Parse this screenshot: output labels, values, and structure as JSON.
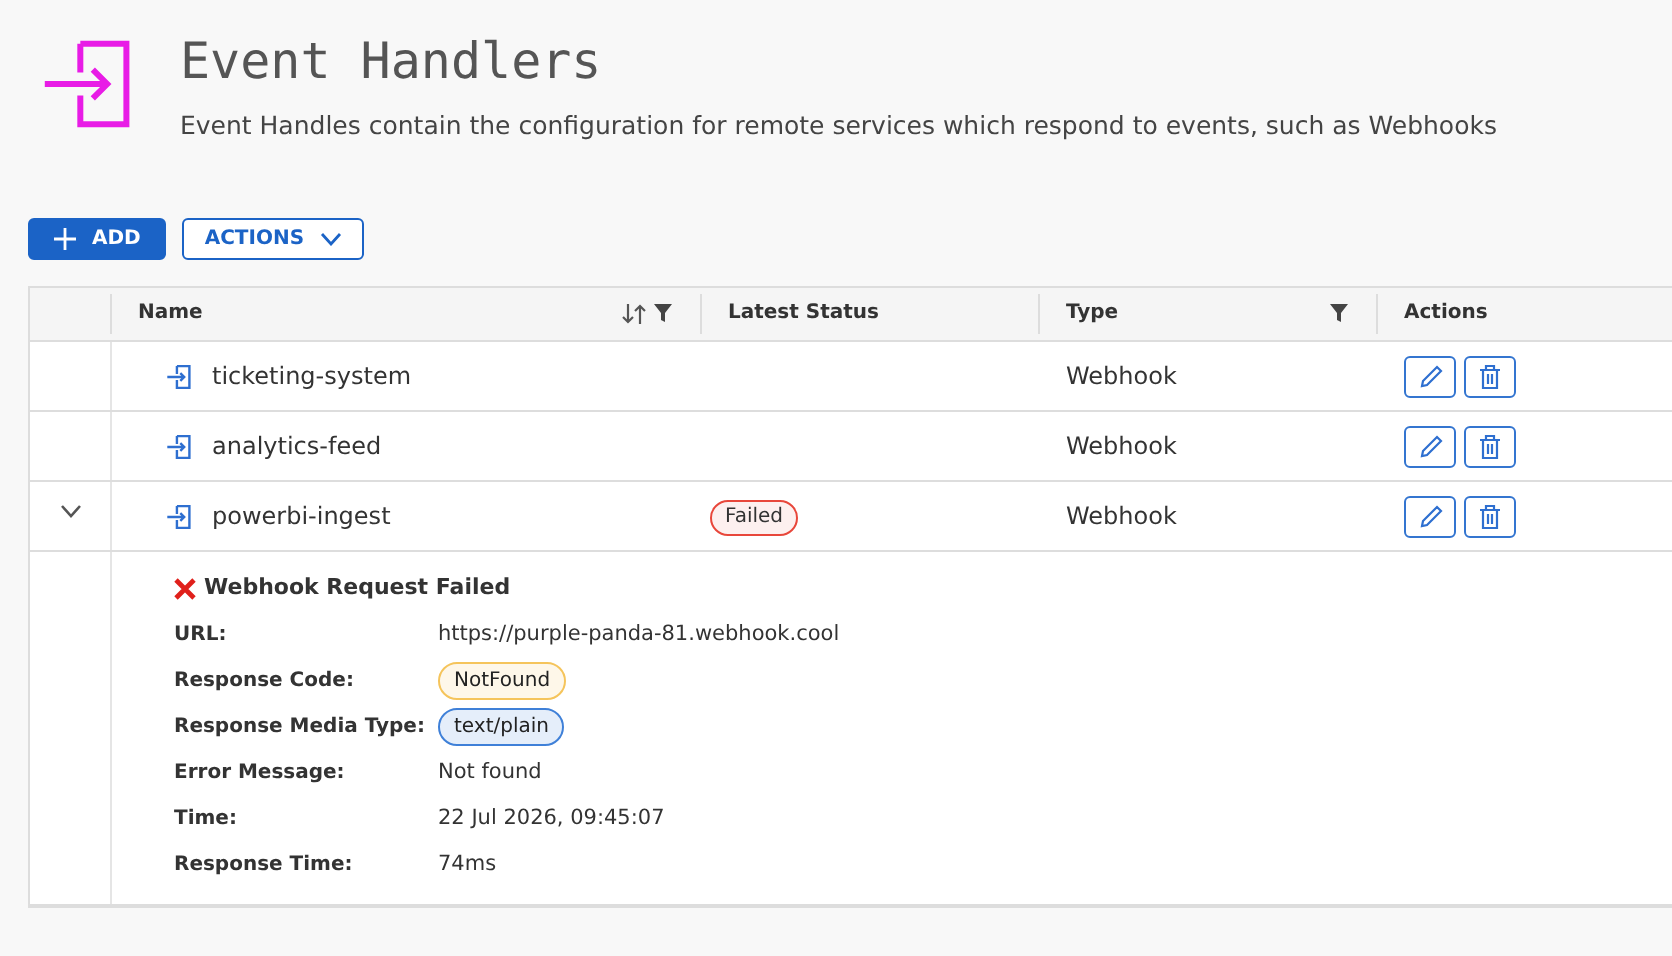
{
  "header": {
    "title": "Event Handlers",
    "subtitle": "Event Handles contain the configuration for remote services which respond to events, such as Webhooks"
  },
  "toolbar": {
    "add_button": "ADD",
    "actions_button": "ACTIONS"
  },
  "table": {
    "columns": [
      {
        "label": "Name",
        "sortable": true,
        "filterable": true
      },
      {
        "label": "Latest Status"
      },
      {
        "label": "Type",
        "filterable": true
      },
      {
        "label": "Actions"
      }
    ],
    "rows": [
      {
        "name": "ticketing-system",
        "type": "Webhook"
      },
      {
        "name": "analytics-feed",
        "type": "Webhook"
      },
      {
        "name": "powerbi-ingest",
        "type": "Webhook",
        "expanded": true,
        "status": {
          "label": "Failed",
          "color": "#e8473b"
        },
        "detail": {
          "title": "Webhook Request Failed",
          "fields": [
            {
              "label": "URL:",
              "value": "https://purple-panda-81.webhook.cool",
              "kind": "text"
            },
            {
              "label": "Response Code:",
              "value": "NotFound",
              "kind": "badge",
              "color": "#f5c45b"
            },
            {
              "label": "Response Media Type:",
              "value": "text/plain",
              "kind": "badge",
              "color": "#3f80d8"
            },
            {
              "label": "Error Message:",
              "value": "Not found",
              "kind": "text"
            },
            {
              "label": "Time:",
              "value": "22 Jul 2026, 09:45:07",
              "kind": "text"
            },
            {
              "label": "Response Time:",
              "value": "74ms",
              "kind": "text"
            }
          ]
        }
      }
    ]
  }
}
